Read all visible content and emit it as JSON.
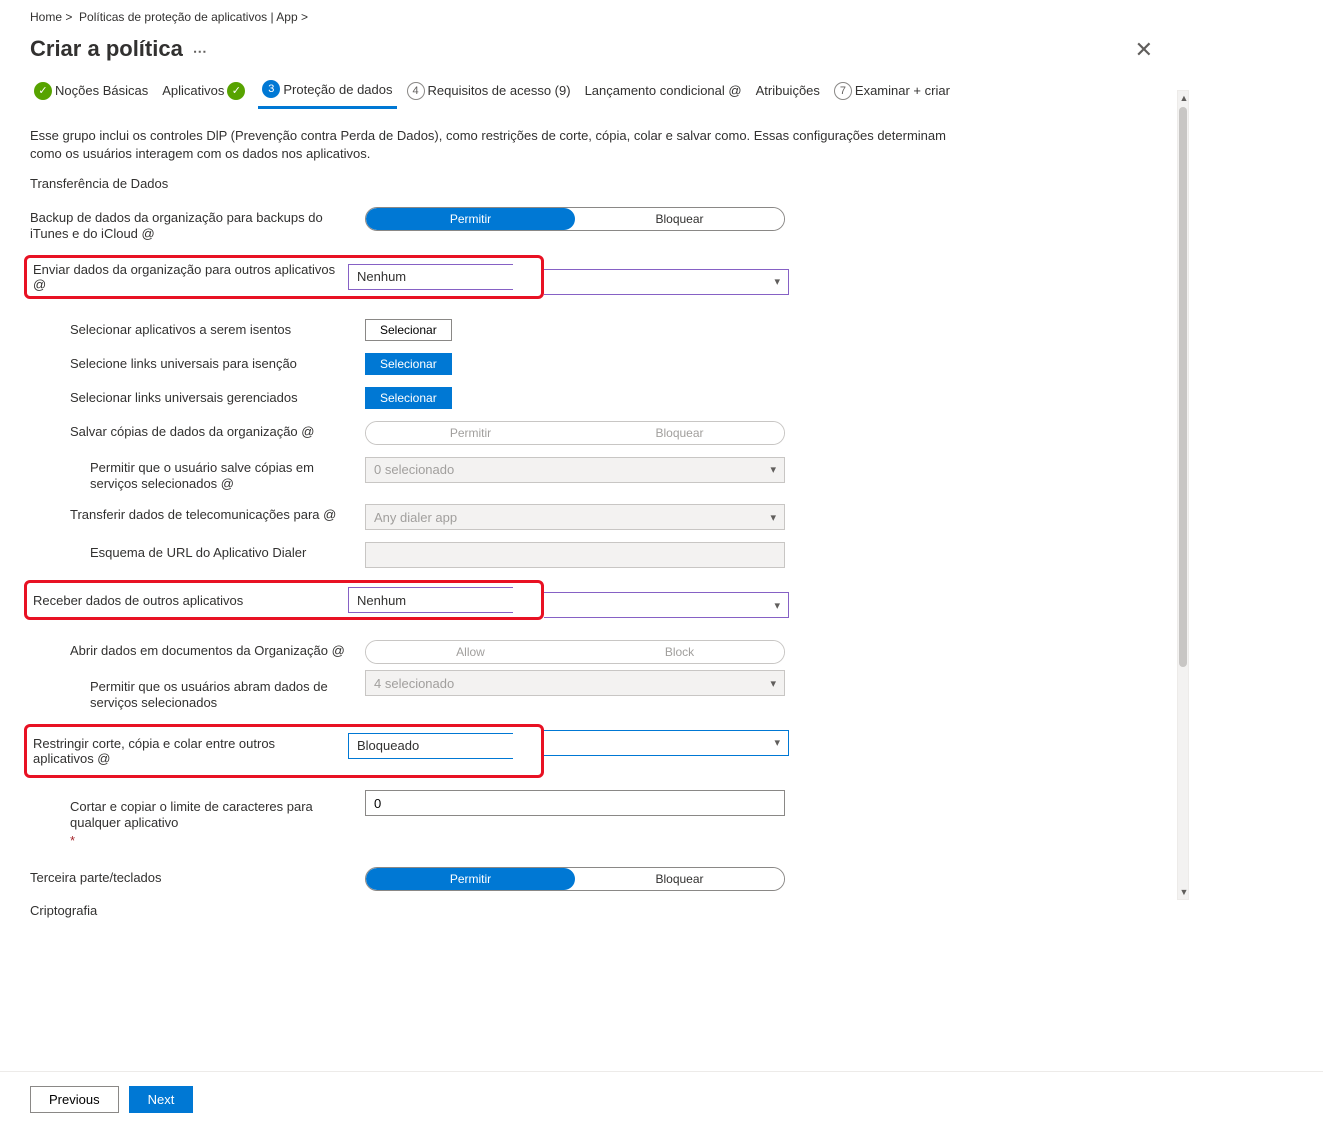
{
  "breadcrumb": {
    "home": "Home",
    "path": "Políticas de proteção de aplicativos | App"
  },
  "title": "Criar a política",
  "tabs": {
    "t1": "Noções Básicas",
    "t2": "Aplicativos",
    "t3_num": "3",
    "t3": "Proteção de dados",
    "t4_num": "4",
    "t4": "Requisitos de acesso (9)",
    "t5": "Lançamento condicional @",
    "t6": "Atribuições",
    "t7_num": "7",
    "t7": "Examinar + criar"
  },
  "intro": "Esse grupo inclui os controles DlP (Prevenção contra Perda de Dados), como restrições de corte, cópia, colar e salvar como. Essas configurações determinam como os usuários interagem com os dados nos aplicativos.",
  "section_transfer": "Transferência de Dados",
  "labels": {
    "backup": "Backup de dados da organização para backups do iTunes e do iCloud @",
    "send_org": "Enviar dados da organização para outros aplicativos @",
    "exempt_apps": "Selecionar aplicativos a serem isentos",
    "exempt_links": "Selecione links universais para isenção",
    "managed_links": "Selecionar links universais gerenciados",
    "save_copies": "Salvar cópias de dados da organização @",
    "allow_save_services": "Permitir que o usuário salve cópias em serviços selecionados @",
    "telecom": "Transferir dados de telecomunicações para @",
    "dialer_scheme": "Esquema de URL do Aplicativo Dialer",
    "receive": "Receber dados de outros aplicativos",
    "open_org_docs": "Abrir dados em documentos da Organização @",
    "allow_open_services": "Permitir que os usuários abram dados de serviços selecionados",
    "restrict_ccp": "Restringir corte, cópia e colar entre outros aplicativos @",
    "char_limit": "Cortar e copiar o limite de caracteres para qualquer aplicativo",
    "third_party_kb": "Terceira parte/teclados",
    "encryption": "Criptografia"
  },
  "values": {
    "permit": "Permitir",
    "block": "Bloquear",
    "allow_en": "Allow",
    "block_en": "Block",
    "none": "Nenhum",
    "select": "Selecionar",
    "zero_selected": "0 selecionado",
    "any_dialer": "Any dialer app",
    "four_selected": "4 selecionado",
    "blocked": "Bloqueado",
    "zero": "0"
  },
  "footer": {
    "prev": "Previous",
    "next": "Next"
  }
}
